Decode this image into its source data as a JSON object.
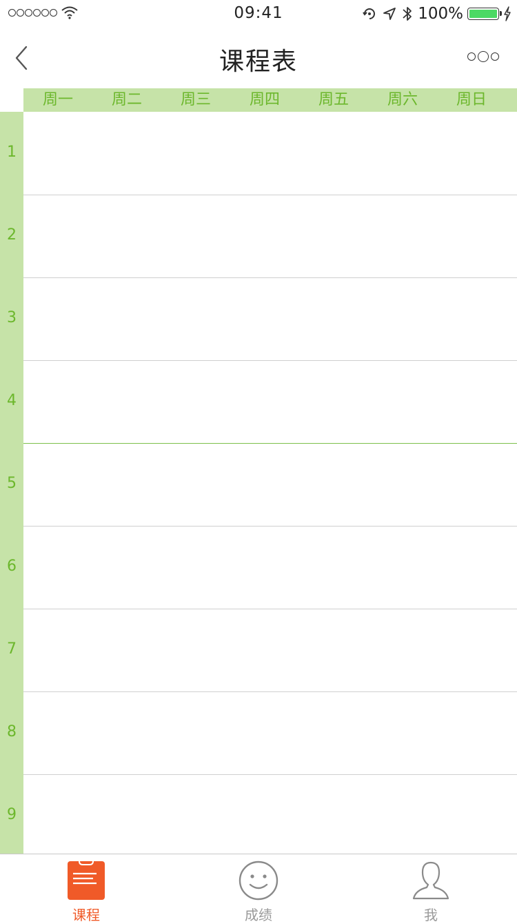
{
  "status_bar": {
    "time": "09:41",
    "battery": "100%"
  },
  "nav": {
    "title": "课程表"
  },
  "weekdays": [
    "周一",
    "周二",
    "周三",
    "周四",
    "周五",
    "周六",
    "周日"
  ],
  "periods": [
    "1",
    "2",
    "3",
    "4",
    "5",
    "6",
    "7",
    "8",
    "9"
  ],
  "tabs": [
    {
      "label": "课程",
      "icon": "clipboard-icon",
      "active": true
    },
    {
      "label": "成绩",
      "icon": "smiley-icon",
      "active": false
    },
    {
      "label": "我",
      "icon": "person-icon",
      "active": false
    }
  ],
  "colors": {
    "accent_green": "#6cb72c",
    "header_bg": "#c6e3a8",
    "tab_active": "#f05a28",
    "tab_inactive": "#9a9a9a",
    "battery": "#4cd964"
  }
}
